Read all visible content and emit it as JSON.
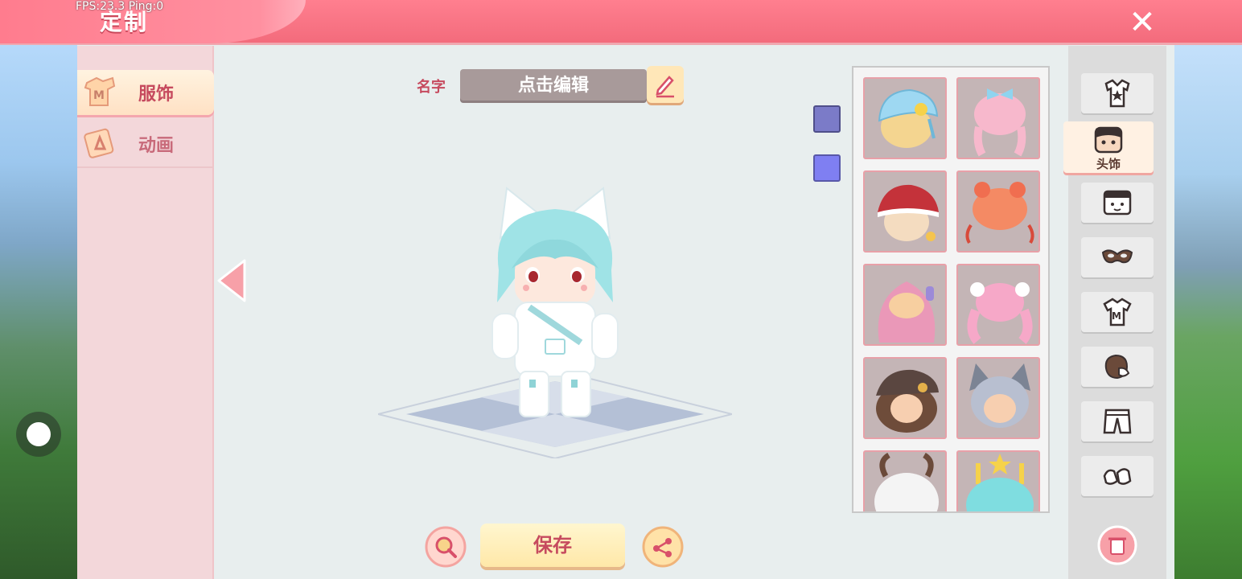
{
  "hud": {
    "fps_text": "FPS:23.3  Ping:0"
  },
  "header": {
    "title": "定制",
    "close_icon": "close-icon"
  },
  "categories": [
    {
      "label": "服饰",
      "icon": "clothing-icon",
      "selected": true
    },
    {
      "label": "动画",
      "icon": "animation-icon",
      "selected": false
    }
  ],
  "name": {
    "label": "名字",
    "value": "点击编辑"
  },
  "colors": {
    "swatch_1": "#7b7bc8",
    "swatch_2": "#7f7ff2",
    "accent": "#f36b7c"
  },
  "actions": {
    "save_label": "保存",
    "zoom_icon": "magnifier-icon",
    "share_icon": "share-icon"
  },
  "item_grid": {
    "items": [
      {
        "name": "blue-hat-blonde-hair"
      },
      {
        "name": "pink-braided-hair-bow"
      },
      {
        "name": "red-christmas-hat"
      },
      {
        "name": "orange-ribbon-hair"
      },
      {
        "name": "pink-long-hair-headphones"
      },
      {
        "name": "pink-twin-tails-flowers"
      },
      {
        "name": "brown-cap-hair"
      },
      {
        "name": "silver-hair-wolf-ears"
      },
      {
        "name": "white-hair-horns"
      },
      {
        "name": "teal-candle-cake-hat"
      }
    ]
  },
  "sidebar": {
    "tabs": [
      {
        "icon": "outfit-icon"
      },
      {
        "icon": "head-icon",
        "label": "头饰",
        "selected": true
      },
      {
        "icon": "face-icon"
      },
      {
        "icon": "mask-icon"
      },
      {
        "icon": "shirt-icon"
      },
      {
        "icon": "glove-icon"
      },
      {
        "icon": "pants-icon"
      },
      {
        "icon": "shoes-icon"
      }
    ]
  }
}
